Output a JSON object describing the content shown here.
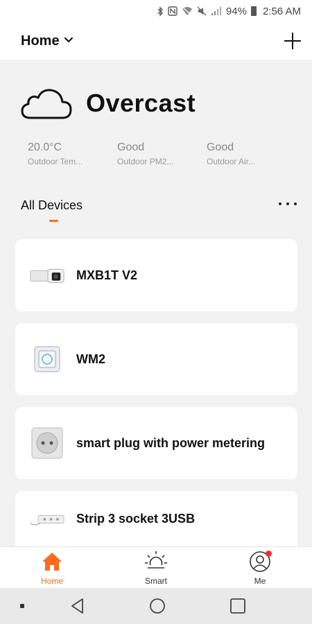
{
  "status_bar": {
    "battery": "94%",
    "time": "2:56 AM"
  },
  "header": {
    "home_label": "Home"
  },
  "weather": {
    "condition": "Overcast",
    "stats": [
      {
        "value": "20.0°C",
        "label": "Outdoor Tem..."
      },
      {
        "value": "Good",
        "label": "Outdoor PM2..."
      },
      {
        "value": "Good",
        "label": "Outdoor Air..."
      }
    ]
  },
  "section": {
    "title": "All Devices"
  },
  "devices": [
    {
      "name": "MXB1T V2"
    },
    {
      "name": "WM2"
    },
    {
      "name": "smart plug with power metering"
    },
    {
      "name": "Strip 3 socket 3USB"
    }
  ],
  "tabs": [
    {
      "label": "Home"
    },
    {
      "label": "Smart"
    },
    {
      "label": "Me"
    }
  ],
  "colors": {
    "accent": "#ff6a1f",
    "badge": "#ff2a2a"
  }
}
